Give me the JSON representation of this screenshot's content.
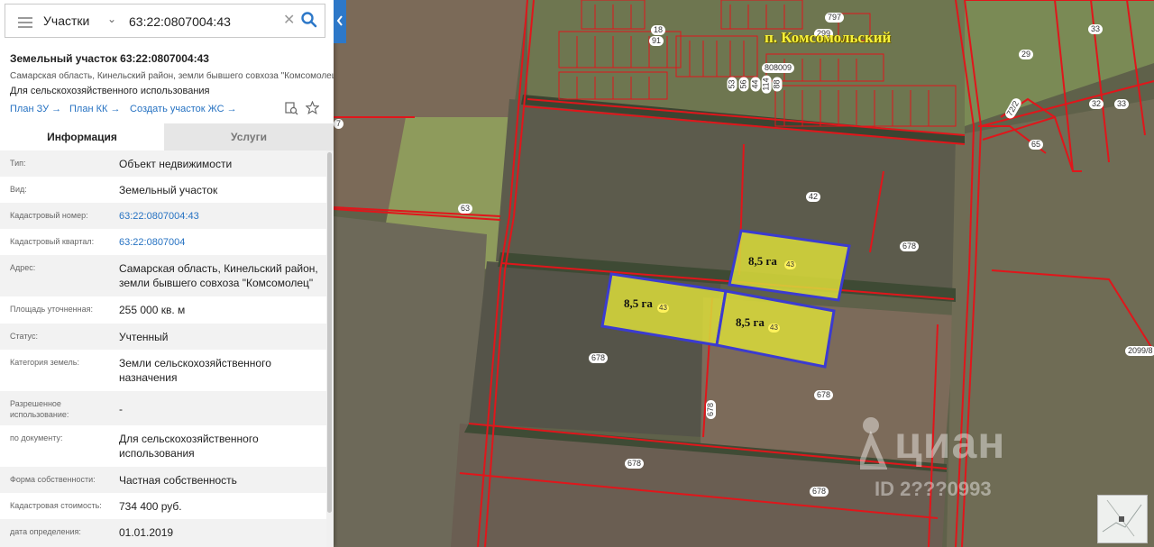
{
  "search": {
    "type_label": "Участки",
    "query": "63:22:0807004:43"
  },
  "object": {
    "title": "Земельный участок 63:22:0807004:43",
    "address": "Самарская область, Кинельский район, земли бывшего совхоза \"Комсомолец\"",
    "use": "Для сельскохозяйственного использования",
    "links": [
      {
        "label": "План ЗУ →"
      },
      {
        "label": "План КК →"
      },
      {
        "label": "Создать участок ЖС →"
      }
    ]
  },
  "tabs": [
    {
      "label": "Информация",
      "active": true
    },
    {
      "label": "Услуги",
      "active": false
    }
  ],
  "properties": [
    {
      "label": "Тип:",
      "value": "Объект недвижимости"
    },
    {
      "label": "Вид:",
      "value": "Земельный участок"
    },
    {
      "label": "Кадастровый номер:",
      "value": "63:22:0807004:43",
      "link": true
    },
    {
      "label": "Кадастровый квартал:",
      "value": "63:22:0807004",
      "link": true
    },
    {
      "label": "Адрес:",
      "value": "Самарская область, Кинельский район, земли бывшего совхоза \"Комсомолец\""
    },
    {
      "label": "Площадь уточненная:",
      "value": "255 000 кв. м"
    },
    {
      "label": "Статус:",
      "value": "Учтенный"
    },
    {
      "label": "Категория земель:",
      "value": "Земли сельскохозяйственного назначения"
    },
    {
      "label": "Разрешенное использование:",
      "value": "-"
    },
    {
      "label": "по документу:",
      "value": "Для сельскохозяйственного использования"
    },
    {
      "label": "Форма собственности:",
      "value": "Частная собственность"
    },
    {
      "label": "Кадастровая стоимость:",
      "value": "734 400 руб."
    },
    {
      "label": "дата определения:",
      "value": "01.01.2019"
    }
  ],
  "map": {
    "settlement": "п. Комсомольский",
    "area_labels": [
      "8,5 га",
      "8,5 га",
      "8,5 га"
    ],
    "area_numbers": [
      "43",
      "43",
      "43"
    ],
    "parcel_labels": [
      "63",
      "42",
      "678",
      "678",
      "678",
      "678",
      "678",
      "678",
      "797",
      "299",
      "29",
      "33",
      "33",
      "32",
      "65",
      "72/2",
      "18",
      "91",
      "808009",
      "53",
      "56",
      "44",
      "114",
      "88",
      "2099/8",
      "7"
    ],
    "watermark": "циан",
    "watermark_id": "ID 2???0993"
  },
  "colors": {
    "accent": "#2d78c8",
    "link": "#2672c2",
    "parcel_border": "#e0161b",
    "selected_border": "#3b3bd0",
    "selected_fill": "#d7d83a",
    "settlement_label": "#f6f13a"
  }
}
